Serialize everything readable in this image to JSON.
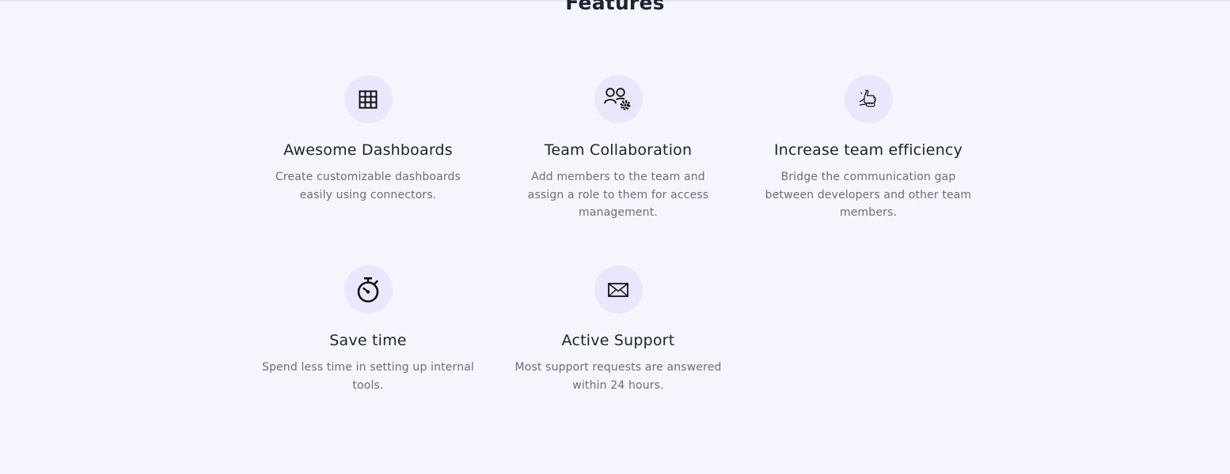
{
  "section": {
    "title": "Features"
  },
  "features": [
    {
      "icon": "grid-table-icon",
      "title": "Awesome Dashboards",
      "description": "Create customizable dashboards easily using connectors."
    },
    {
      "icon": "team-settings-icon",
      "title": "Team Collaboration",
      "description": "Add members to the team and assign a role to them for access management."
    },
    {
      "icon": "handshake-icon",
      "title": "Increase team efficiency",
      "description": "Bridge the communication gap between developers and other team members."
    },
    {
      "icon": "stopwatch-icon",
      "title": "Save time",
      "description": "Spend less time in setting up internal tools."
    },
    {
      "icon": "envelope-icon",
      "title": "Active Support",
      "description": "Most support requests are answered within 24 hours."
    }
  ],
  "colors": {
    "background": "#f5f5fe",
    "icon_circle": "#ebe6fc",
    "heading": "#1c2430",
    "body_text": "#6b6f78"
  }
}
